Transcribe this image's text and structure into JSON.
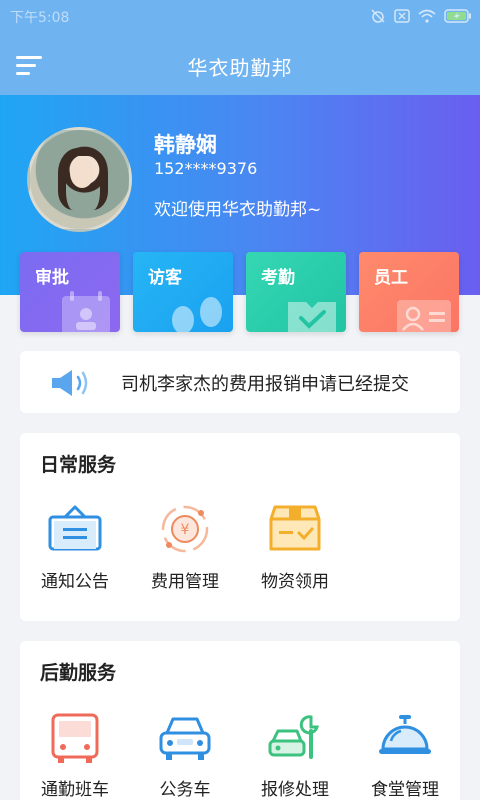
{
  "status": {
    "time": "下午5:08"
  },
  "header": {
    "title": "华衣助勤邦"
  },
  "profile": {
    "name": "韩静娴",
    "phone": "152****9376",
    "welcome": "欢迎使用华衣助勤邦~"
  },
  "quick_cards": [
    {
      "label": "审批",
      "icon": "calendar-person-icon",
      "color": "#7a6cf2"
    },
    {
      "label": "访客",
      "icon": "footprints-icon",
      "color": "#27b5f5"
    },
    {
      "label": "考勤",
      "icon": "check-box-icon",
      "color": "#35d7b3"
    },
    {
      "label": "员工",
      "icon": "id-card-icon",
      "color": "#ff8a6c"
    }
  ],
  "notice": {
    "icon": "speaker-icon",
    "text": "司机李家杰的费用报销申请已经提交"
  },
  "daily_services": {
    "title": "日常服务",
    "items": [
      {
        "label": "通知公告",
        "icon": "basket-icon"
      },
      {
        "label": "费用管理",
        "icon": "yuan-coin-icon"
      },
      {
        "label": "物资领用",
        "icon": "package-box-icon"
      }
    ]
  },
  "logistics_services": {
    "title": "后勤服务",
    "items": [
      {
        "label": "通勤班车",
        "icon": "bus-icon"
      },
      {
        "label": "公务车",
        "icon": "car-icon"
      },
      {
        "label": "报修处理",
        "icon": "repair-wrench-icon"
      },
      {
        "label": "食堂管理",
        "icon": "food-cloche-icon"
      }
    ]
  }
}
